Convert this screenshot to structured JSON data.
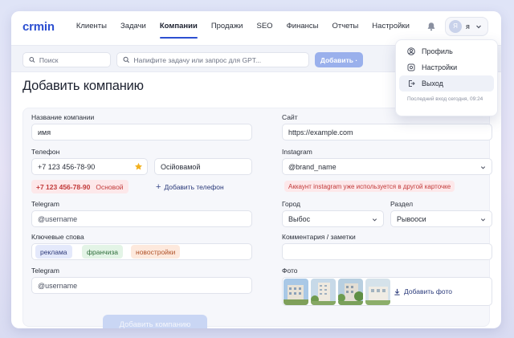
{
  "app": {
    "logo": "crmin"
  },
  "nav": {
    "items": [
      {
        "label": "Клиенты",
        "active": false
      },
      {
        "label": "Задачи",
        "active": false
      },
      {
        "label": "Компании",
        "active": true
      },
      {
        "label": "Продажи",
        "active": false
      },
      {
        "label": "SEO",
        "active": false
      },
      {
        "label": "Финансы",
        "active": false
      },
      {
        "label": "Отчеты",
        "active": false
      },
      {
        "label": "Настройки",
        "active": false
      }
    ],
    "accent_color": "#2c4fd1"
  },
  "user": {
    "avatar_letter": "Я",
    "name": "я"
  },
  "toolbar": {
    "search_placeholder": "Поиск",
    "gpt_placeholder": "Напифите задачу или запрос для GPT...",
    "gpt_button": "Добавить ·"
  },
  "user_menu": {
    "items": [
      {
        "label": "Профиль",
        "icon": "user-icon"
      },
      {
        "label": "Настройки",
        "icon": "settings-icon"
      },
      {
        "label": "Выход",
        "icon": "logout-icon"
      }
    ],
    "last_login": "Последний вход сегодня, 09:24"
  },
  "page": {
    "title": "Добавить компанию"
  },
  "form": {
    "company_name": {
      "label": "Название компании",
      "value": "имя"
    },
    "phone": {
      "label": "Телефон",
      "value": "+7 123 456-78-90",
      "second_value": "Осійовамой",
      "primary_chip": "+7 123 456-78-90",
      "primary_chip_sub": "Основой",
      "add_label": "Добавить телефон"
    },
    "telegram": {
      "label": "Telegram",
      "value": "@username"
    },
    "keywords": {
      "label": "Ключевые спова",
      "chips": [
        "реклама",
        "франчиза",
        "новостройки"
      ]
    },
    "telegram2": {
      "label": "Telegram",
      "value": "@username"
    },
    "submit_label": "Добавить компанию",
    "site": {
      "label": "Сайт",
      "value": "https://example.com"
    },
    "instagram": {
      "label": "Instagram",
      "value": "@brand_name",
      "error": "Аккаунт instagram уже используется в другой карточке"
    },
    "city": {
      "label": "Город",
      "value": "Выбос"
    },
    "section": {
      "label": "Раздел",
      "value": "Рывооси"
    },
    "comment": {
      "label": "Комментария / заметки",
      "value": ""
    },
    "photo": {
      "label": "Фото",
      "add_label": "Добавить фото"
    }
  }
}
